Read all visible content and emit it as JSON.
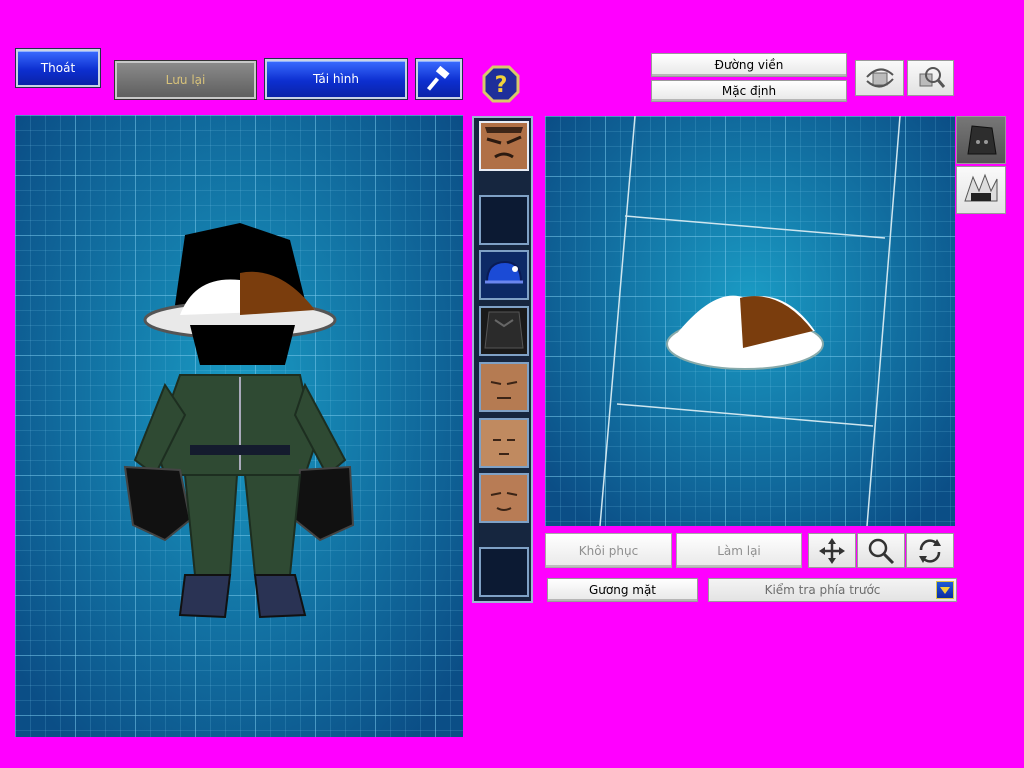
{
  "toolbar": {
    "exit_label": "Thoát",
    "save_label": "Lưu lại",
    "regenerate_label": "Tái hình",
    "help_symbol": "?"
  },
  "right_top": {
    "outline_label": "Đường viền",
    "default_label": "Mặc định"
  },
  "parts_column": {
    "slots": [
      {
        "icon": "face-angry-icon"
      },
      {
        "icon": "empty-slot"
      },
      {
        "icon": "helmet-blue-icon"
      },
      {
        "icon": "armor-dark-icon"
      },
      {
        "icon": "face-tan-1-icon"
      },
      {
        "icon": "face-tan-2-icon"
      },
      {
        "icon": "face-tan-3-icon"
      },
      {
        "icon": "empty-slot"
      }
    ]
  },
  "editor_controls": {
    "restore_label": "Khôi phục",
    "redo_label": "Làm lại",
    "face_label": "Gương mặt",
    "view_select_value": "Kiểm tra phía trước"
  },
  "colors": {
    "background": "#ff00ff",
    "viewport": "#0f7fa3",
    "button_blue": "#0d2fd0"
  }
}
